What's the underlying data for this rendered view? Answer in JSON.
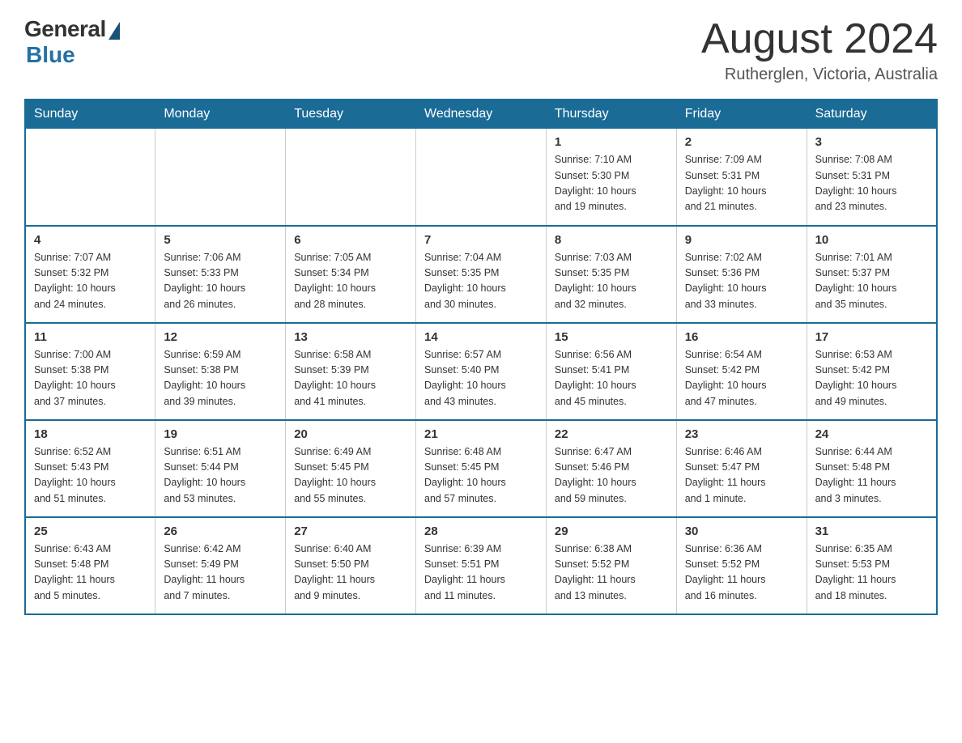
{
  "header": {
    "logo_general": "General",
    "logo_blue": "Blue",
    "month_title": "August 2024",
    "location": "Rutherglen, Victoria, Australia"
  },
  "days_of_week": [
    "Sunday",
    "Monday",
    "Tuesday",
    "Wednesday",
    "Thursday",
    "Friday",
    "Saturday"
  ],
  "weeks": [
    [
      {
        "day": "",
        "info": ""
      },
      {
        "day": "",
        "info": ""
      },
      {
        "day": "",
        "info": ""
      },
      {
        "day": "",
        "info": ""
      },
      {
        "day": "1",
        "info": "Sunrise: 7:10 AM\nSunset: 5:30 PM\nDaylight: 10 hours\nand 19 minutes."
      },
      {
        "day": "2",
        "info": "Sunrise: 7:09 AM\nSunset: 5:31 PM\nDaylight: 10 hours\nand 21 minutes."
      },
      {
        "day": "3",
        "info": "Sunrise: 7:08 AM\nSunset: 5:31 PM\nDaylight: 10 hours\nand 23 minutes."
      }
    ],
    [
      {
        "day": "4",
        "info": "Sunrise: 7:07 AM\nSunset: 5:32 PM\nDaylight: 10 hours\nand 24 minutes."
      },
      {
        "day": "5",
        "info": "Sunrise: 7:06 AM\nSunset: 5:33 PM\nDaylight: 10 hours\nand 26 minutes."
      },
      {
        "day": "6",
        "info": "Sunrise: 7:05 AM\nSunset: 5:34 PM\nDaylight: 10 hours\nand 28 minutes."
      },
      {
        "day": "7",
        "info": "Sunrise: 7:04 AM\nSunset: 5:35 PM\nDaylight: 10 hours\nand 30 minutes."
      },
      {
        "day": "8",
        "info": "Sunrise: 7:03 AM\nSunset: 5:35 PM\nDaylight: 10 hours\nand 32 minutes."
      },
      {
        "day": "9",
        "info": "Sunrise: 7:02 AM\nSunset: 5:36 PM\nDaylight: 10 hours\nand 33 minutes."
      },
      {
        "day": "10",
        "info": "Sunrise: 7:01 AM\nSunset: 5:37 PM\nDaylight: 10 hours\nand 35 minutes."
      }
    ],
    [
      {
        "day": "11",
        "info": "Sunrise: 7:00 AM\nSunset: 5:38 PM\nDaylight: 10 hours\nand 37 minutes."
      },
      {
        "day": "12",
        "info": "Sunrise: 6:59 AM\nSunset: 5:38 PM\nDaylight: 10 hours\nand 39 minutes."
      },
      {
        "day": "13",
        "info": "Sunrise: 6:58 AM\nSunset: 5:39 PM\nDaylight: 10 hours\nand 41 minutes."
      },
      {
        "day": "14",
        "info": "Sunrise: 6:57 AM\nSunset: 5:40 PM\nDaylight: 10 hours\nand 43 minutes."
      },
      {
        "day": "15",
        "info": "Sunrise: 6:56 AM\nSunset: 5:41 PM\nDaylight: 10 hours\nand 45 minutes."
      },
      {
        "day": "16",
        "info": "Sunrise: 6:54 AM\nSunset: 5:42 PM\nDaylight: 10 hours\nand 47 minutes."
      },
      {
        "day": "17",
        "info": "Sunrise: 6:53 AM\nSunset: 5:42 PM\nDaylight: 10 hours\nand 49 minutes."
      }
    ],
    [
      {
        "day": "18",
        "info": "Sunrise: 6:52 AM\nSunset: 5:43 PM\nDaylight: 10 hours\nand 51 minutes."
      },
      {
        "day": "19",
        "info": "Sunrise: 6:51 AM\nSunset: 5:44 PM\nDaylight: 10 hours\nand 53 minutes."
      },
      {
        "day": "20",
        "info": "Sunrise: 6:49 AM\nSunset: 5:45 PM\nDaylight: 10 hours\nand 55 minutes."
      },
      {
        "day": "21",
        "info": "Sunrise: 6:48 AM\nSunset: 5:45 PM\nDaylight: 10 hours\nand 57 minutes."
      },
      {
        "day": "22",
        "info": "Sunrise: 6:47 AM\nSunset: 5:46 PM\nDaylight: 10 hours\nand 59 minutes."
      },
      {
        "day": "23",
        "info": "Sunrise: 6:46 AM\nSunset: 5:47 PM\nDaylight: 11 hours\nand 1 minute."
      },
      {
        "day": "24",
        "info": "Sunrise: 6:44 AM\nSunset: 5:48 PM\nDaylight: 11 hours\nand 3 minutes."
      }
    ],
    [
      {
        "day": "25",
        "info": "Sunrise: 6:43 AM\nSunset: 5:48 PM\nDaylight: 11 hours\nand 5 minutes."
      },
      {
        "day": "26",
        "info": "Sunrise: 6:42 AM\nSunset: 5:49 PM\nDaylight: 11 hours\nand 7 minutes."
      },
      {
        "day": "27",
        "info": "Sunrise: 6:40 AM\nSunset: 5:50 PM\nDaylight: 11 hours\nand 9 minutes."
      },
      {
        "day": "28",
        "info": "Sunrise: 6:39 AM\nSunset: 5:51 PM\nDaylight: 11 hours\nand 11 minutes."
      },
      {
        "day": "29",
        "info": "Sunrise: 6:38 AM\nSunset: 5:52 PM\nDaylight: 11 hours\nand 13 minutes."
      },
      {
        "day": "30",
        "info": "Sunrise: 6:36 AM\nSunset: 5:52 PM\nDaylight: 11 hours\nand 16 minutes."
      },
      {
        "day": "31",
        "info": "Sunrise: 6:35 AM\nSunset: 5:53 PM\nDaylight: 11 hours\nand 18 minutes."
      }
    ]
  ]
}
